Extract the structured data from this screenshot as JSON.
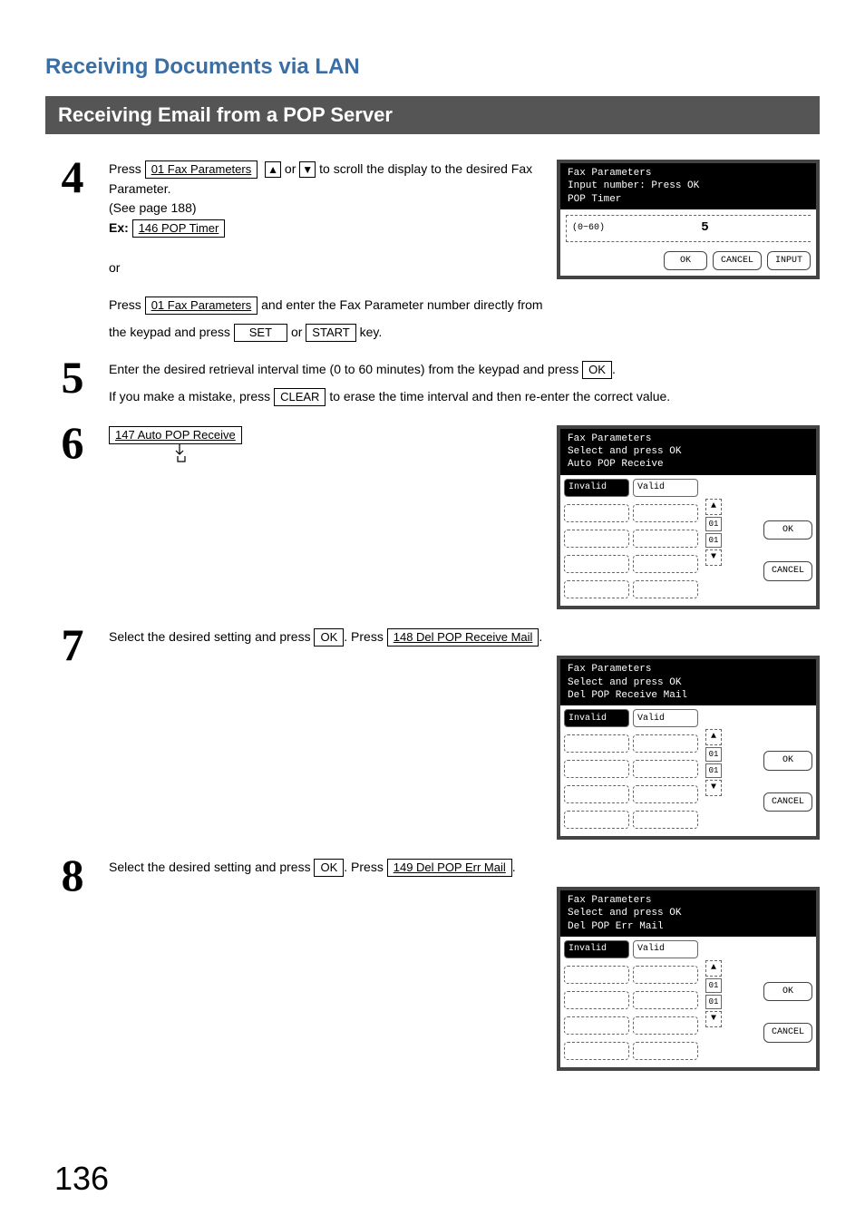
{
  "section_title": "Receiving Documents via LAN",
  "subsection_title": "Receiving Email from a POP Server",
  "page_number": "136",
  "buttons": {
    "fax_params": "01 Fax Parameters",
    "pop_timer": "146 POP Timer",
    "auto_pop_receive": "147 Auto POP Receive",
    "del_pop_receive_mail": "148 Del POP Receive Mail",
    "del_pop_err_mail": "149 Del POP Err Mail",
    "set": "SET",
    "start": "START",
    "ok": "OK",
    "clear": "CLEAR",
    "cancel": "CANCEL",
    "input": "INPUT",
    "invalid": "Invalid",
    "valid": "Valid"
  },
  "step4": {
    "num": "4",
    "text_a": "Press ",
    "text_b": " or ",
    "text_c": " to scroll the display to the desired Fax Parameter.",
    "see_page": "(See page 188)",
    "ex_label": "Ex:",
    "or": "or",
    "press2a": "Press ",
    "press2b": " and enter the Fax Parameter number directly from",
    "press2c": "the keypad and press ",
    "press2d": " or ",
    "press2e": " key.",
    "lcd": {
      "line1": "Fax Parameters",
      "line2": "Input number: Press OK",
      "line3": "POP Timer",
      "range": "(0~60)",
      "value": "5"
    }
  },
  "step5": {
    "num": "5",
    "text_a": "Enter the desired retrieval interval time (0 to 60 minutes) from the keypad and press ",
    "text_b": ".",
    "text_c": "If you make a mistake, press ",
    "text_d": " to erase the time interval and then re-enter the correct value."
  },
  "step6": {
    "num": "6",
    "lcd": {
      "line1": "Fax Parameters",
      "line2": "Select and press OK",
      "line3": "Auto POP Receive",
      "idx_top": "01",
      "idx_bot": "01"
    }
  },
  "step7": {
    "num": "7",
    "text_a": "Select the desired setting and press ",
    "text_b": ".  Press ",
    "text_c": ".",
    "lcd": {
      "line1": "Fax Parameters",
      "line2": "Select and press OK",
      "line3": "Del POP Receive Mail",
      "idx_top": "01",
      "idx_bot": "01"
    }
  },
  "step8": {
    "num": "8",
    "text_a": "Select the desired setting and press ",
    "text_b": ".  Press ",
    "text_c": ".",
    "lcd": {
      "line1": "Fax Parameters",
      "line2": "Select and press OK",
      "line3": "Del POP Err Mail",
      "idx_top": "01",
      "idx_bot": "01"
    }
  }
}
